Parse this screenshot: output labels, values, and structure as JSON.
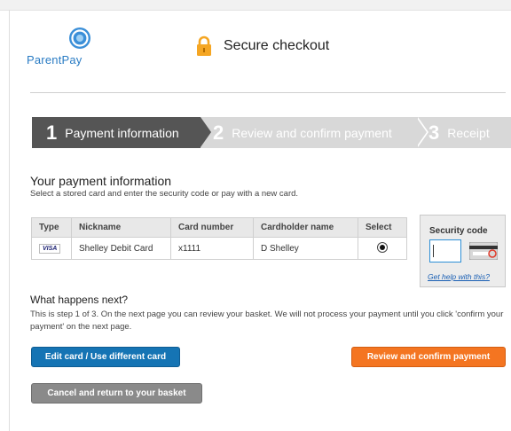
{
  "brand": {
    "name": "ParentPay"
  },
  "header": {
    "secure_label": "Secure checkout"
  },
  "steps": [
    {
      "num": "1",
      "label": "Payment information"
    },
    {
      "num": "2",
      "label": "Review and confirm payment"
    },
    {
      "num": "3",
      "label": "Receipt"
    }
  ],
  "payment": {
    "heading": "Your payment information",
    "subheading": "Select a stored card and enter the security code or pay with a new card."
  },
  "table": {
    "headers": [
      "Type",
      "Nickname",
      "Card number",
      "Cardholder name",
      "Select"
    ],
    "rows": [
      {
        "type": "VISA",
        "nickname": "Shelley Debit Card",
        "card_number": "x1111",
        "cardholder": "D Shelley"
      }
    ]
  },
  "security": {
    "title": "Security code",
    "value": "",
    "help_link": "Get help with this?"
  },
  "next": {
    "heading": "What happens next?",
    "text": "This is step 1 of 3. On the next page you can review your basket. We will not process your payment until you click 'confirm your payment' on the next page."
  },
  "buttons": {
    "edit": "Edit card / Use different card",
    "review": "Review and confirm payment",
    "cancel": "Cancel and return to your basket"
  },
  "colors": {
    "step_active": "#555555",
    "step_inactive": "#d8d8d8",
    "edit_button": "#1574b4",
    "review_button": "#f47521",
    "cancel_button": "#8a8a8a",
    "lock": "#f5a623"
  },
  "icons": [
    "parentpay-logo-icon",
    "lock-icon",
    "visa-icon",
    "card-cvv-icon"
  ]
}
